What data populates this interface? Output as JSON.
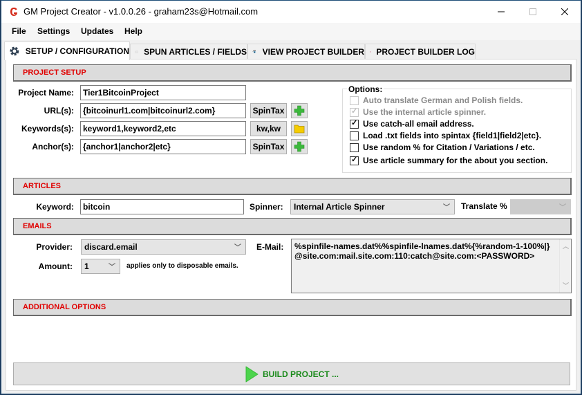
{
  "window": {
    "title": "GM Project Creator - v1.0.0.26 - graham23s@Hotmail.com",
    "controls": {
      "minimize": "—",
      "maximize": "☐",
      "close": "✕"
    }
  },
  "menu": [
    "File",
    "Settings",
    "Updates",
    "Help"
  ],
  "tabs": [
    {
      "label": "SETUP / CONFIGURATION",
      "icon": "gear-icon",
      "active": true
    },
    {
      "label": "SPUN ARTICLES / FIELDS",
      "icon": "document-icon",
      "active": false
    },
    {
      "label": "VIEW PROJECT BUILDER",
      "icon": "eye-icon",
      "active": false
    },
    {
      "label": "PROJECT BUILDER LOG",
      "icon": "log-file-icon",
      "active": false
    }
  ],
  "project_setup": {
    "header": "PROJECT SETUP",
    "fields": {
      "project_name": {
        "label": "Project Name:",
        "value": "Tier1BitcoinProject"
      },
      "urls": {
        "label": "URL(s):",
        "value": "{bitcoinurl1.com|bitcoinurl2.com}",
        "button": "SpinTax"
      },
      "keywords": {
        "label": "Keywords(s):",
        "value": "keyword1,keyword2,etc",
        "button": "kw,kw"
      },
      "anchors": {
        "label": "Anchor(s):",
        "value": "{anchor1|anchor2|etc}",
        "button": "SpinTax"
      }
    },
    "options": {
      "legend": "Options:",
      "items": [
        {
          "label": "Auto translate German and Polish fields.",
          "checked": false,
          "enabled": false
        },
        {
          "label": "Use the internal article spinner.",
          "checked": true,
          "enabled": false
        },
        {
          "label": "Use catch-all email address.",
          "checked": true,
          "enabled": true
        },
        {
          "label": "Load .txt fields into spintax {field1|field2|etc}.",
          "checked": false,
          "enabled": true
        },
        {
          "label": "Use random % for Citation / Variations / etc.",
          "checked": false,
          "enabled": true
        },
        {
          "label": "Use article summary for the about you section.",
          "checked": true,
          "enabled": true
        }
      ]
    }
  },
  "articles": {
    "header": "ARTICLES",
    "keyword_label": "Keyword:",
    "keyword_value": "bitcoin",
    "spinner_label": "Spinner:",
    "spinner_value": "Internal Article Spinner",
    "translate_label": "Translate %",
    "translate_value": ""
  },
  "emails": {
    "header": "EMAILS",
    "provider_label": "Provider:",
    "provider_value": "discard.email",
    "amount_label": "Amount:",
    "amount_value": "1",
    "amount_note": "applies only to disposable emails.",
    "email_label": "E-Mail:",
    "email_line1": "%spinfile-names.dat%%spinfile-lnames.dat%{%random-1-100%|}",
    "email_line2": "@site.com:mail.site.com:110:catch@site.com:<PASSWORD>"
  },
  "additional_options": {
    "header": "ADDITIONAL OPTIONS"
  },
  "build_button": {
    "label": "BUILD PROJECT ..."
  },
  "colors": {
    "section_header_text": "#e00000",
    "build_text": "#1a8a1a",
    "plus_green": "#3cb83c",
    "folder_yellow": "#f5cc00"
  }
}
